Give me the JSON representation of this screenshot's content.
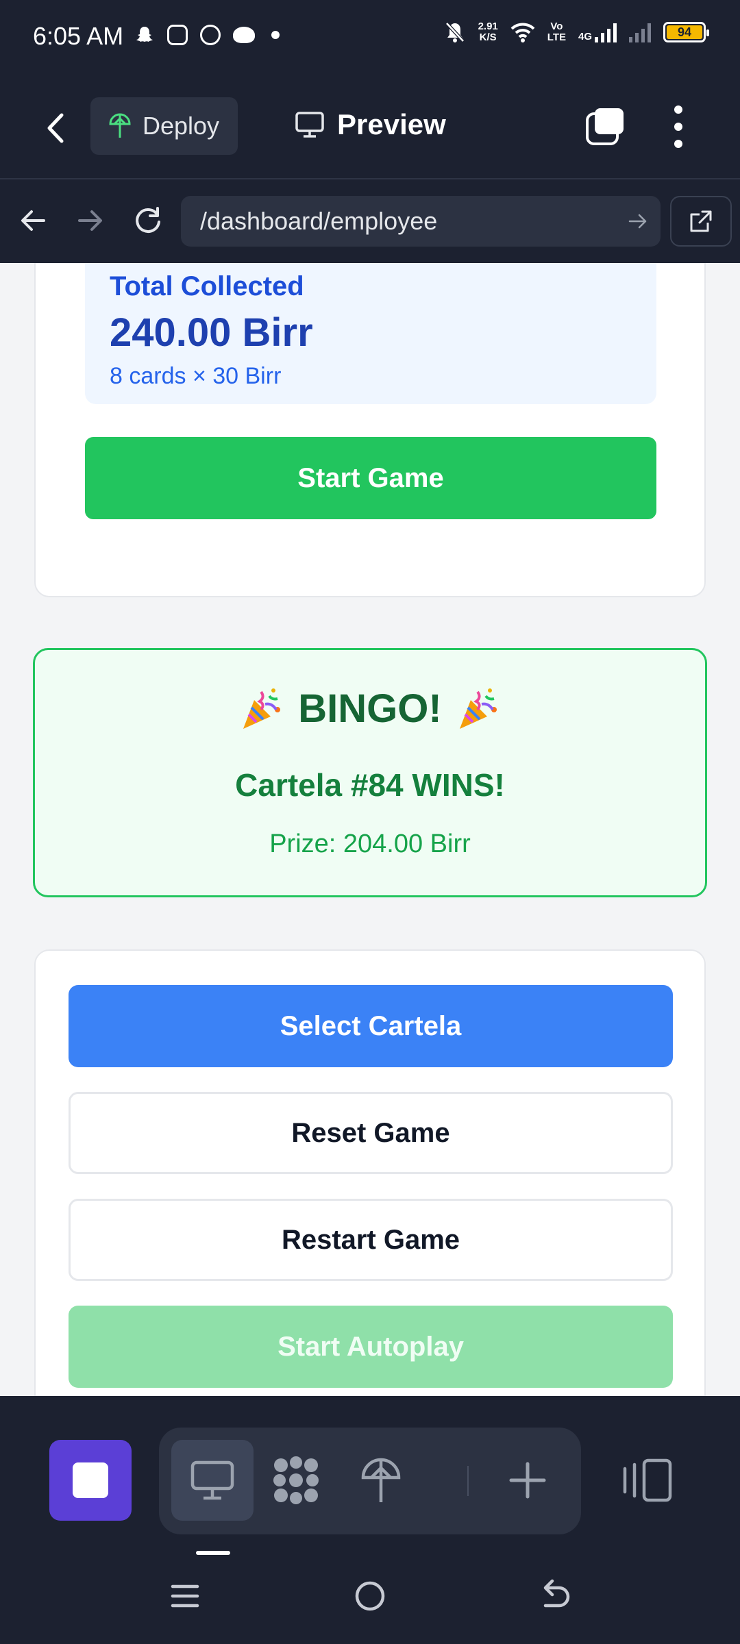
{
  "status_bar": {
    "time": "6:05 AM",
    "net_speed_value": "2.91",
    "net_speed_unit": "K/S",
    "volte_top": "Vo",
    "volte_bottom": "LTE",
    "network": "4G",
    "battery": "94",
    "battery_color": "#f5b800"
  },
  "header": {
    "deploy_label": "Deploy",
    "preview_label": "Preview"
  },
  "url_bar": {
    "url": "/dashboard/employee"
  },
  "collection": {
    "label": "Total Collected",
    "value": "240.00 Birr",
    "detail": "8 cards × 30 Birr",
    "start_button": "Start Game"
  },
  "winner": {
    "title": "BINGO!",
    "subtitle": "Cartela #84 WINS!",
    "prize": "Prize: 204.00 Birr"
  },
  "actions": {
    "select": "Select Cartela",
    "reset": "Reset Game",
    "restart": "Restart Game",
    "autoplay": "Start Autoplay"
  },
  "colors": {
    "primary_green": "#22c55e",
    "primary_blue": "#3b82f6",
    "accent_purple": "#5b3fd6",
    "chrome_dark": "#1c2130"
  }
}
